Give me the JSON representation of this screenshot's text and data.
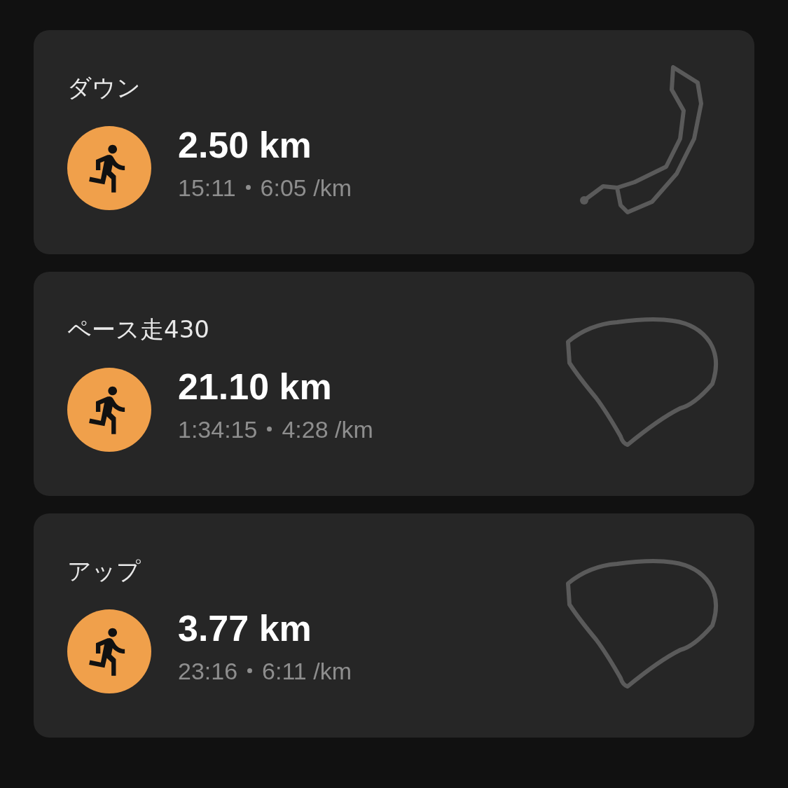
{
  "activities": [
    {
      "kind": "hook",
      "title": "ダウン",
      "distance": "2.50 km",
      "stats": [
        "15:11",
        "6:05 /km"
      ]
    },
    {
      "kind": "loop",
      "title": "ペース走430",
      "distance": "21.10 km",
      "stats": [
        "1:34:15",
        "4:28 /km"
      ]
    },
    {
      "kind": "loop",
      "title": "アップ",
      "distance": "3.77 km",
      "stats": [
        "23:16",
        "6:11 /km"
      ]
    }
  ]
}
